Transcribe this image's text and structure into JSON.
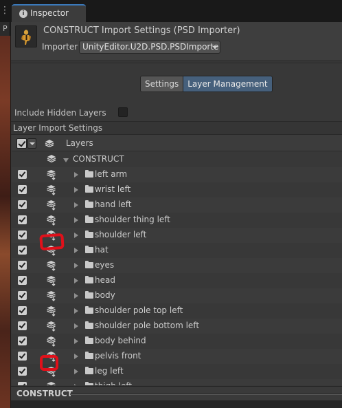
{
  "window": {
    "tab_label": "Inspector",
    "left_tab_letter": "P"
  },
  "header": {
    "title": "CONSTRUCT Import Settings (PSD Importer)",
    "importer_label": "Importer",
    "importer_value": "UnityEditor.U2D.PSD.PSDImporte"
  },
  "tabs": {
    "settings": "Settings",
    "layer_management": "Layer Management",
    "active": "Layer Management"
  },
  "options": {
    "include_hidden_layers_label": "Include Hidden Layers",
    "include_hidden_layers_checked": false
  },
  "section": {
    "layer_import_settings": "Layer Import Settings"
  },
  "tree": {
    "column_header": "Layers",
    "root": "CONSTRUCT",
    "rows": [
      {
        "label": "left arm"
      },
      {
        "label": "wrist left"
      },
      {
        "label": "hand left"
      },
      {
        "label": "shoulder thing left"
      },
      {
        "label": "shoulder left"
      },
      {
        "label": "hat"
      },
      {
        "label": "eyes"
      },
      {
        "label": "head"
      },
      {
        "label": "body"
      },
      {
        "label": "shoulder pole top left"
      },
      {
        "label": "shoulder pole bottom left"
      },
      {
        "label": "body behind"
      },
      {
        "label": "pelvis front"
      },
      {
        "label": "leg left"
      },
      {
        "label": "thigh left"
      }
    ]
  },
  "footer": {
    "label": "CONSTRUCT"
  },
  "colors": {
    "accent_tab": "#3a79bb",
    "active_segment": "#46607c",
    "annotation_red": "#e0101a"
  }
}
